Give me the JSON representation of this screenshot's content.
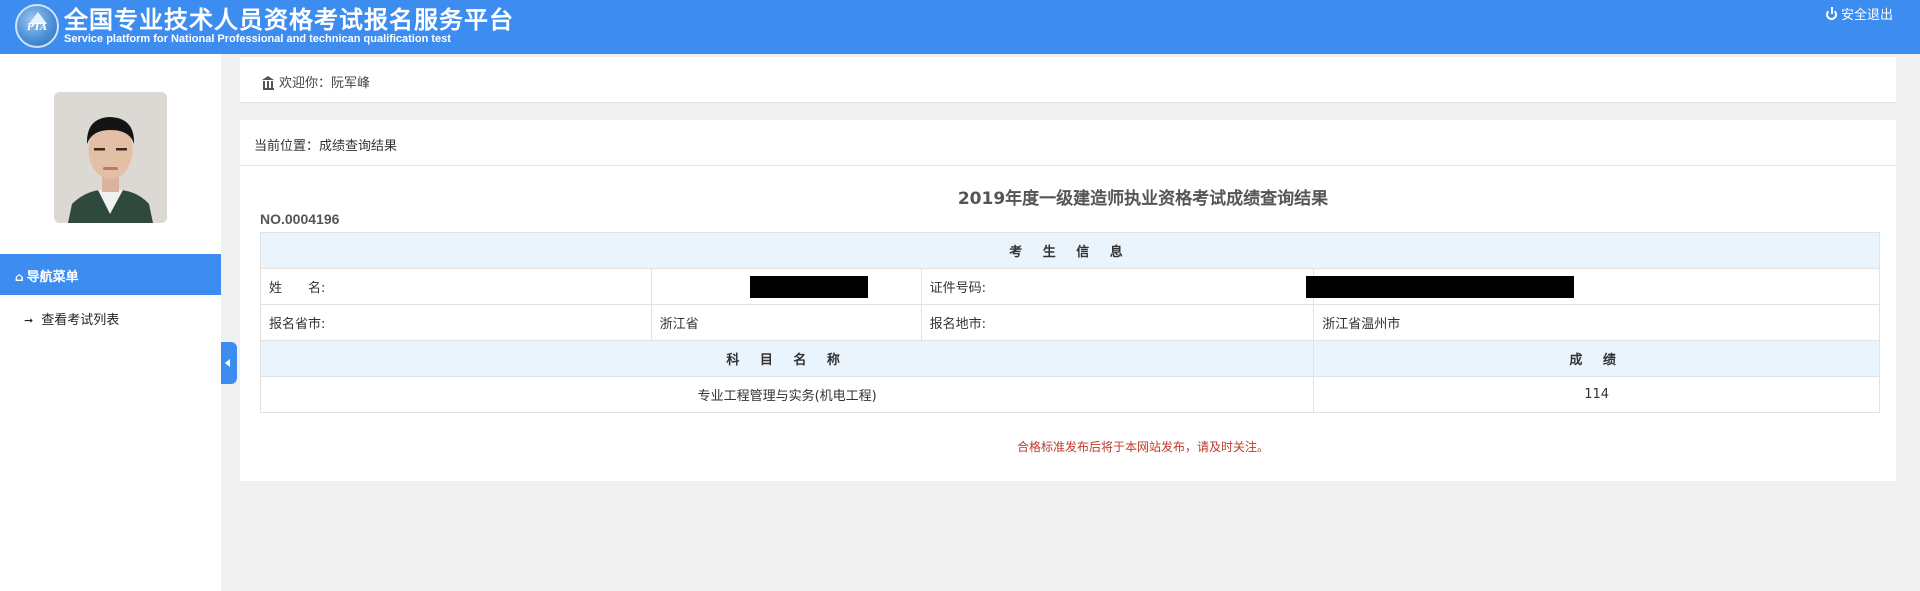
{
  "header": {
    "logo_text": "PTA",
    "title": "全国专业技术人员资格考试报名服务平台",
    "subtitle": "Service platform for National Professional and technican qualification test",
    "logout_label": "安全退出"
  },
  "sidebar": {
    "nav_title": "导航菜单",
    "items": [
      {
        "label": "查看考试列表"
      }
    ]
  },
  "welcome": {
    "text": "欢迎你：阮军峰"
  },
  "breadcrumb": {
    "text": "当前位置：成绩查询结果"
  },
  "result": {
    "title": "2019年度一级建造师执业资格考试成绩查询结果",
    "number": "NO.0004196",
    "section_header": "考 生 信 息",
    "name_label": "姓　　名:",
    "id_label": "证件号码:",
    "province_label": "报名省市:",
    "province_value": "浙江省",
    "city_label": "报名地市:",
    "city_value": "浙江省温州市",
    "subject_header": "科 目 名 称",
    "score_header": "成 绩",
    "rows": [
      {
        "subject": "专业工程管理与实务(机电工程)",
        "score": "114"
      }
    ],
    "notice": "合格标准发布后将于本网站发布，请及时关注。"
  },
  "colors": {
    "brand": "#3d8df0",
    "table_header_bg": "#eaf4fc",
    "notice": "#c0392b"
  }
}
